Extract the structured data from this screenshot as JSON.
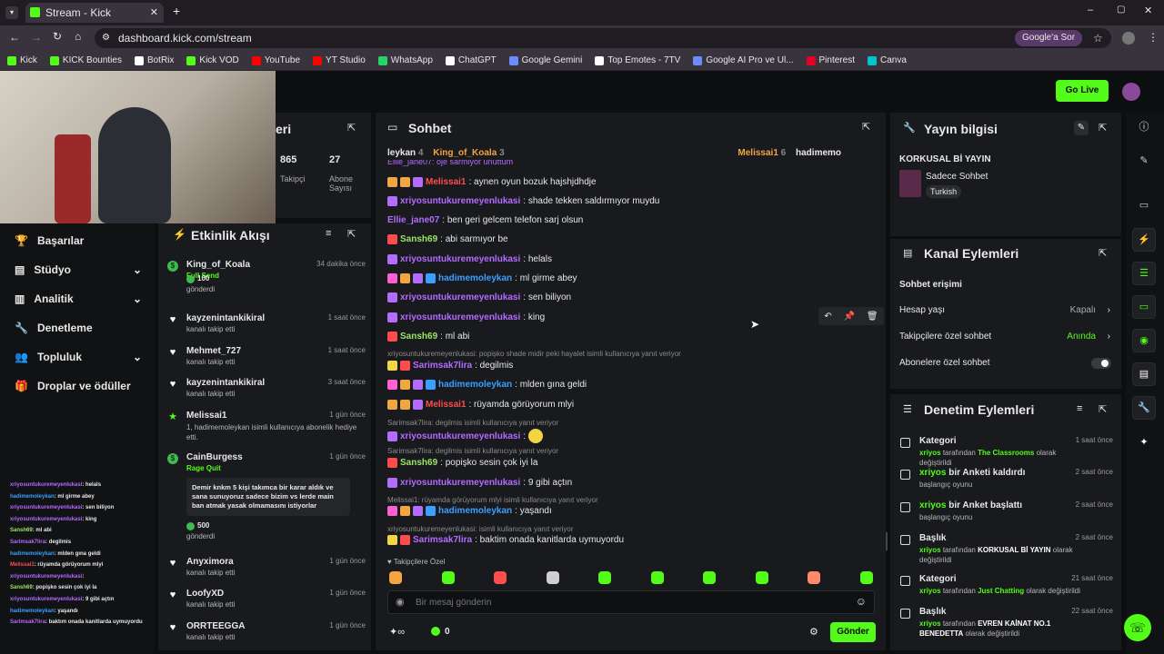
{
  "browser": {
    "tab_title": "Stream - Kick Dashboard",
    "url": "dashboard.kick.com/stream",
    "google_label": "Google'a Sor",
    "bookmarks": [
      "Kick",
      "KICK Bounties",
      "BotRix",
      "Kick VOD",
      "YouTube",
      "YT Studio",
      "WhatsApp",
      "ChatGPT",
      "Google Gemini",
      "Top Emotes - 7TV",
      "Google AI Pro ve Ul...",
      "Pinterest",
      "Canva"
    ]
  },
  "header": {
    "go_live": "Go Live"
  },
  "stats": {
    "title_partial": "eri",
    "followers": "865",
    "followers_label": "Takipçi",
    "subs": "27",
    "subs_label": "Abone Sayısı"
  },
  "sidebar": {
    "items": [
      "Başarılar",
      "Stüdyo",
      "Analitik",
      "Denetleme",
      "Topluluk",
      "Droplar ve ödüller"
    ]
  },
  "activity": {
    "title": "Etkinlik Akışı",
    "items": [
      {
        "name": "King_of_Koala",
        "time": "34 dakika önce",
        "sub": "Full Send",
        "extra": "100",
        "extra2": "gönderdi"
      },
      {
        "name": "kayzenintankikiral",
        "time": "1 saat önce",
        "sub": "kanalı takip etti"
      },
      {
        "name": "Mehmet_727",
        "time": "1 saat önce",
        "sub": "kanalı takip etti"
      },
      {
        "name": "kayzenintankikiral",
        "time": "3 saat önce",
        "sub": "kanalı takip etti"
      },
      {
        "name": "Melissai1",
        "time": "1 gün önce",
        "sub": "1, hadimemoleykan isimli kullanıcıya abonelik hediye etti."
      },
      {
        "name": "CainBurgess",
        "time": "1 gün önce",
        "sub": "Rage Quit",
        "msg": "Demir knkm 5 kişi takımca bir karar aldık ve sana sunuyoruz sadece bizim vs lerde main ban atmak yasak olmamasını istiyorlar",
        "extra": "500",
        "extra2": "gönderdi"
      },
      {
        "name": "Anyximora",
        "time": "1 gün önce",
        "sub": "kanalı takip etti"
      },
      {
        "name": "LoofyXD",
        "time": "1 gün önce",
        "sub": "kanalı takip etti"
      },
      {
        "name": "ORRTEEGGA",
        "time": "1 gün önce",
        "sub": "kanalı takip etti"
      }
    ]
  },
  "chat": {
    "title": "Sohbet",
    "top": [
      "leykan",
      "4",
      "King_of_Koala",
      "3",
      "Melissai1",
      "6",
      "hadimemo"
    ],
    "partial_line": "Ellie_jane07: oje sarmiyor unuttum",
    "lines": [
      {
        "user": "Melissai1",
        "msg": ": aynen oyun bozuk hajshjdhdje"
      },
      {
        "user": "xriyosuntukuremeyenlukasi",
        "msg": ": shade tekken saldırmıyor muydu"
      },
      {
        "user": "Ellie_jane07",
        "msg": ": ben geri gelcem telefon sarj olsun"
      },
      {
        "user": "Sansh69",
        "msg": ": abi sarmıyor be"
      },
      {
        "user": "xriyosuntukuremeyenlukasi",
        "msg": ": helals"
      },
      {
        "user": "hadimemoleykan",
        "msg": ": ml girme abey"
      },
      {
        "user": "xriyosuntukuremeyenlukasi",
        "msg": ": sen biliyon"
      },
      {
        "user": "xriyosuntukuremeyenlukasi",
        "msg": ": king"
      },
      {
        "user": "Sansh69",
        "msg": ": ml abi"
      },
      {
        "reply": "xriyosuntukuremeyenlukasi: popişko shade midir peki hayalet isimli kullanıcıya yanıt veriyor"
      },
      {
        "user": "Sarimsak7lira",
        "msg": ": degilmis"
      },
      {
        "user": "hadimemoleykan",
        "msg": ": mlden gına geldi"
      },
      {
        "user": "Melissai1",
        "msg": ": rüyamda görüyorum mlyi"
      },
      {
        "reply": "Sarimsak7lira: degilmis isimli kullanıcıya yanıt veriyor"
      },
      {
        "user": "xriyosuntukuremeyenlukasi",
        "msg": ":"
      },
      {
        "reply": "Sarimsak7lira: degilmis isimli kullanıcıya yanıt veriyor"
      },
      {
        "user": "Sansh69",
        "msg": ": popişko sesin çok iyi la"
      },
      {
        "user": "xriyosuntukuremeyenlukasi",
        "msg": ": 9 gibi açtın"
      },
      {
        "reply": "Melissai1: rüyamda görüyorum mlyi isimli kullanıcıya yanıt veriyor"
      },
      {
        "user": "hadimemoleykan",
        "msg": ": yaşandı"
      },
      {
        "reply": "xriyosuntukuremeyenlukasi: isimli kullanıcıya yanıt veriyor"
      },
      {
        "user": "Sarimsak7lira",
        "msg": ": baktim onada kanitlarda uymuyordu"
      }
    ],
    "emote_label": "Takipçilere Özel",
    "placeholder": "Bir mesaj gönderin",
    "points": "0",
    "send": "Gönder"
  },
  "stream_info": {
    "title": "Yayın bilgisi",
    "stream_title": "KORKUSAL Bİ YAYIN",
    "category": "Sadece Sohbet",
    "language": "Turkish"
  },
  "channel_actions": {
    "title": "Kanal Eylemleri",
    "section": "Sohbet erişimi",
    "rows": [
      {
        "label": "Hesap yaşı",
        "value": "Kapalı"
      },
      {
        "label": "Takipçilere özel sohbet",
        "value": "Anında"
      },
      {
        "label": "Abonelere özel sohbet",
        "value": ""
      }
    ]
  },
  "mod_actions": {
    "title": "Denetim Eylemleri",
    "items": [
      {
        "t": "Kategori",
        "d1": "xriyos",
        "d2": "tarafından",
        "d3": "The Classrooms",
        "d4": "olarak değiştirildi",
        "time": "1 saat önce"
      },
      {
        "t1": "xriyos",
        "t2": "bir Anketi kaldırdı",
        "d": "başlangıç oyunu",
        "time": "2 saat önce"
      },
      {
        "t1": "xriyos",
        "t2": "bir Anket başlattı",
        "d": "başlangıç oyunu",
        "time": "2 saat önce"
      },
      {
        "t": "Başlık",
        "d1": "xriyos",
        "d2": "tarafından",
        "d3": "KORKUSAL Bİ YAYIN",
        "d4": "olarak değiştirildi",
        "time": "2 saat önce"
      },
      {
        "t": "Kategori",
        "d1": "xriyos",
        "d2": "tarafından",
        "d3": "Just Chatting",
        "d4": "olarak değiştirildi",
        "time": "21 saat önce"
      },
      {
        "t": "Başlık",
        "d1": "xriyos",
        "d2": "tarafından",
        "d3": "EVREN KAİNAT NO.1 BENEDETTA",
        "d4": "olarak değiştirildi",
        "time": "22 saat önce"
      }
    ]
  },
  "overlay_chat": [
    {
      "u": "xriyosuntukuremeyenlukasi",
      "m": ": helals"
    },
    {
      "u": "hadimemoleykan",
      "m": ": ml girme abey"
    },
    {
      "u": "xriyosuntukuremeyenlukasi",
      "m": ": sen biliyon"
    },
    {
      "u": "xriyosuntukuremeyenlukasi",
      "m": ": king"
    },
    {
      "u": "Sansh69",
      "m": ": ml abi"
    },
    {
      "u": "Sarimsak7lira",
      "m": ": degilmis"
    },
    {
      "u": "hadimemoleykan",
      "m": ": mlden gına geldi"
    },
    {
      "u": "Melissai1",
      "m": ": rüyamda görüyorum mlyi"
    },
    {
      "u": "xriyosuntukuremeyenlukasi",
      "m": ":"
    },
    {
      "u": "Sansh69",
      "m": ": popişko sesin çok iyi la"
    },
    {
      "u": "xriyosuntukuremeyenlukasi",
      "m": ": 9 gibi açtın"
    },
    {
      "u": "hadimemoleykan",
      "m": ": yaşandı"
    },
    {
      "u": "Sarimsak7lira",
      "m": ": baktım onada kanitlarda uymuyordu"
    }
  ],
  "colors": {
    "accent": "#53fc18",
    "purple": "#b46bff",
    "blue": "#3aa0ff",
    "red": "#ff4d4d"
  }
}
